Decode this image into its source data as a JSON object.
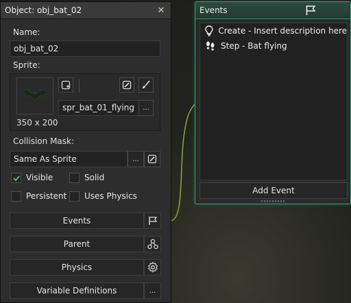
{
  "object_panel": {
    "title": "Object: obj_bat_02",
    "name_label": "Name:",
    "name_value": "obj_bat_02",
    "sprite_label": "Sprite:",
    "sprite_name": "spr_bat_01_flying",
    "sprite_size": "350 x 200",
    "collision_label": "Collision Mask:",
    "collision_value": "Same As Sprite",
    "ellipsis": "...",
    "checkboxes": [
      {
        "label": "Visible",
        "checked": true
      },
      {
        "label": "Solid",
        "checked": false
      },
      {
        "label": "Persistent",
        "checked": false
      },
      {
        "label": "Uses Physics",
        "checked": false
      }
    ],
    "buttons": {
      "events": "Events",
      "parent": "Parent",
      "physics": "Physics",
      "variable_definitions": "Variable Definitions"
    }
  },
  "events_panel": {
    "title": "Events",
    "events": [
      {
        "label": "Create - Insert description here",
        "icon": "lightbulb-icon"
      },
      {
        "label": "Step - Bat flying",
        "icon": "footsteps-icon"
      }
    ],
    "add_event": "Add Event"
  },
  "colors": {
    "accent_green": "#2ba678",
    "check_green": "#58c06a",
    "panel_bg": "#2d2d2d"
  }
}
